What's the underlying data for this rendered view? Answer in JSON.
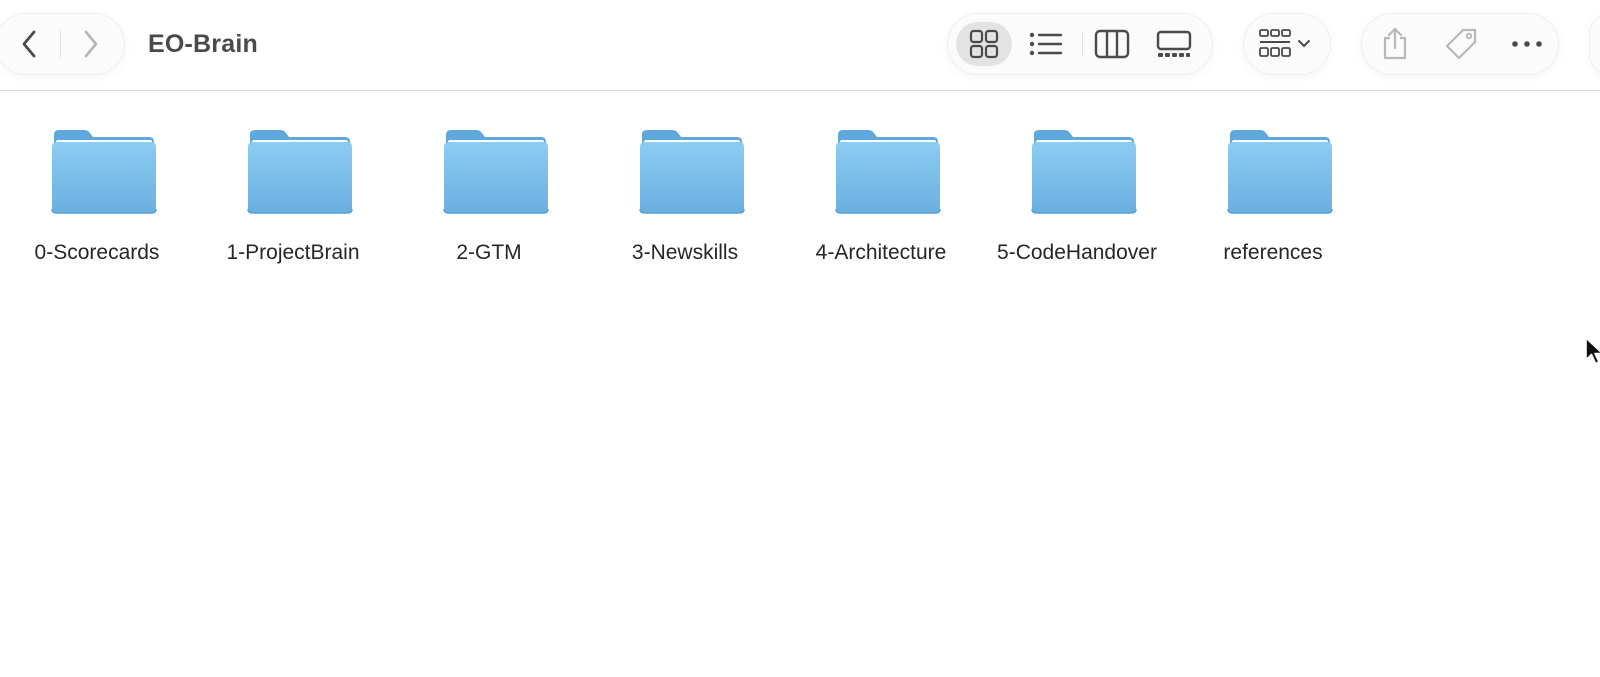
{
  "window": {
    "title": "EO-Brain"
  },
  "navigation": {
    "back_icon": "chevron-left-icon",
    "forward_icon": "chevron-right-icon"
  },
  "view_modes": {
    "selected": "icons",
    "items": [
      {
        "id": "icons",
        "icon": "icon-view-icon"
      },
      {
        "id": "list",
        "icon": "list-view-icon"
      },
      {
        "id": "columns",
        "icon": "column-view-icon"
      },
      {
        "id": "gallery",
        "icon": "gallery-view-icon"
      }
    ]
  },
  "toolbar_actions": {
    "group": "group-by-icon",
    "share": "share-icon",
    "tag": "tag-icon",
    "more": "more-icon"
  },
  "folders": [
    {
      "name": "0-Scorecards"
    },
    {
      "name": "1-ProjectBrain"
    },
    {
      "name": "2-GTM"
    },
    {
      "name": "3-Newskills"
    },
    {
      "name": "4-Architecture"
    },
    {
      "name": "5-CodeHandover"
    },
    {
      "name": "references"
    }
  ],
  "colors": {
    "folder_top": "#8ccdf3",
    "folder_bottom": "#69afe0",
    "folder_tab": "#5fa8dd",
    "active_view_bg": "#e3e3e3",
    "icon_gray": "#5a5a5a",
    "icon_disabled": "#b8b8b8"
  }
}
